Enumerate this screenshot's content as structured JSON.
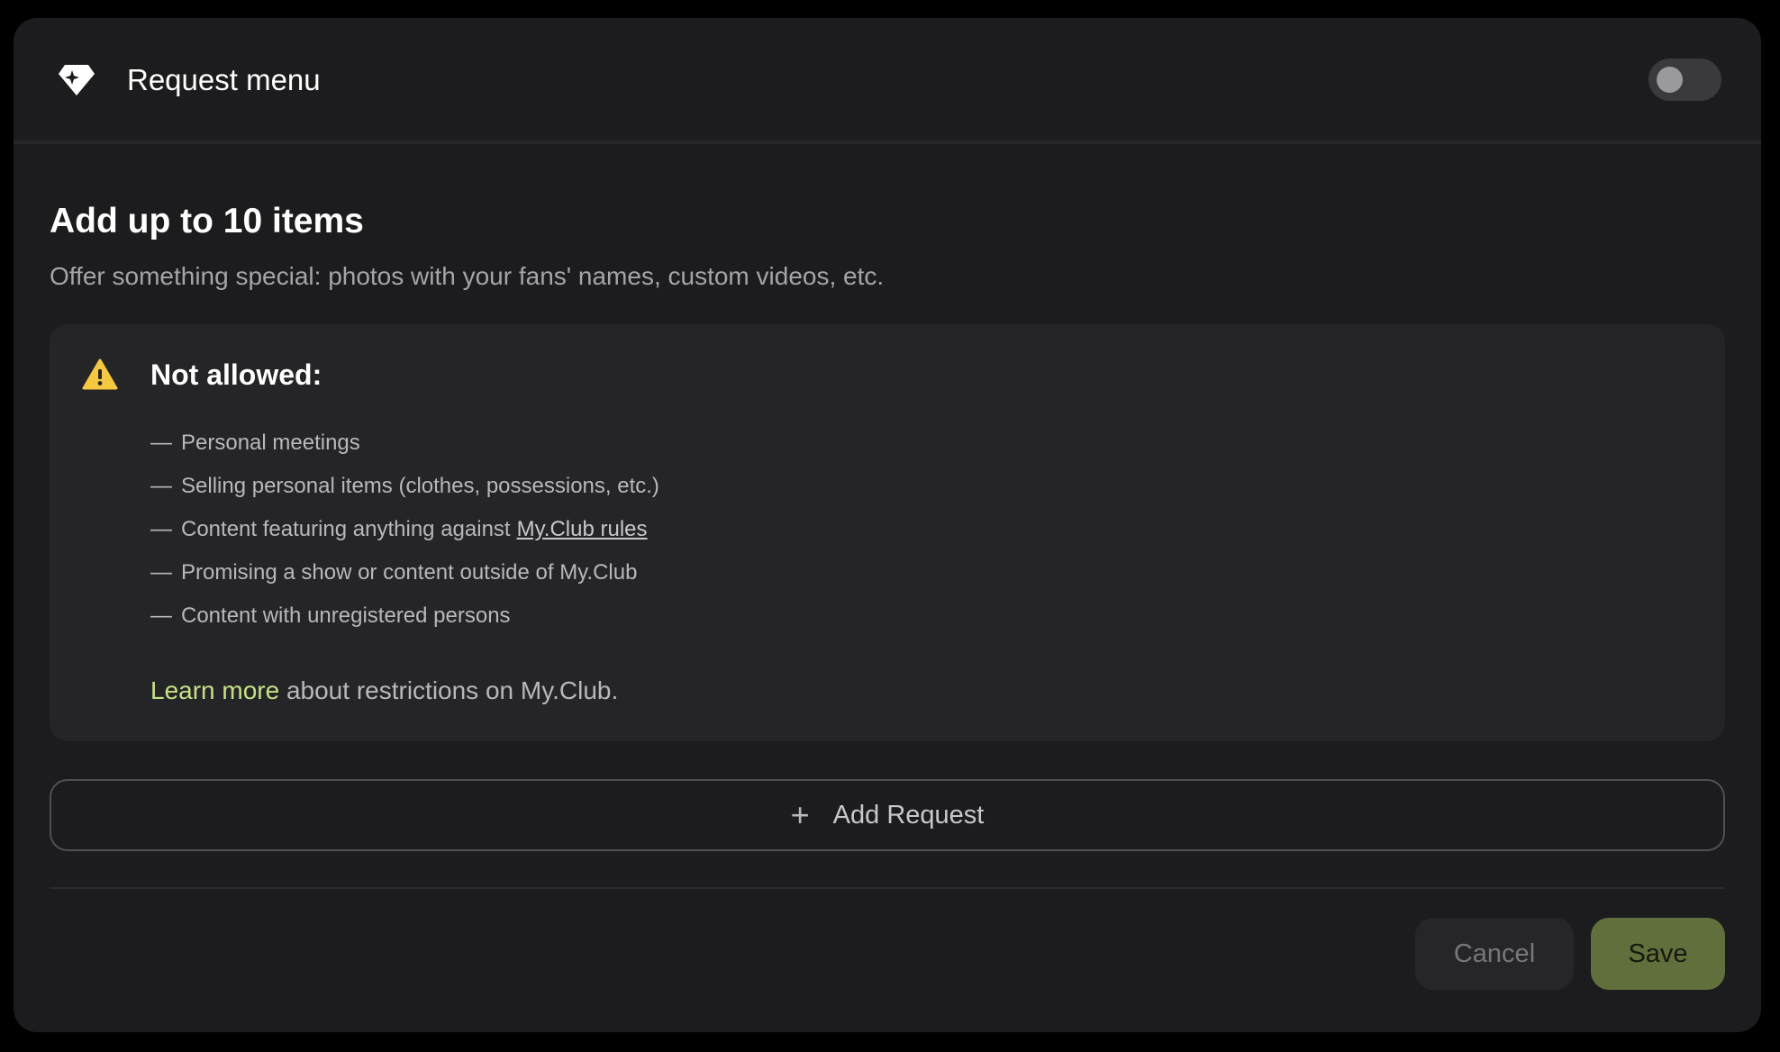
{
  "header": {
    "icon": "gem-icon",
    "title": "Request menu",
    "toggle_on": false
  },
  "main": {
    "heading": "Add up to 10 items",
    "subtitle": "Offer something special: photos with your fans' names, custom videos, etc."
  },
  "notice": {
    "icon": "warning-icon",
    "title": "Not allowed:",
    "dash": "—",
    "items": [
      "Personal meetings",
      "Selling personal items (clothes, possessions, etc.)",
      "Content featuring anything against",
      "Promising a show or content outside of My.Club",
      "Content with unregistered persons"
    ],
    "rules_link": "My.Club rules",
    "learn_link": "Learn more",
    "learn_text": " about restrictions on My.Club."
  },
  "add_button": {
    "icon": "plus-icon",
    "plus": "+",
    "label": "Add Request"
  },
  "footer": {
    "cancel_label": "Cancel",
    "save_label": "Save"
  },
  "colors": {
    "accent": "#c5e186",
    "save_bg": "#616f3c",
    "warning": "#f5c842"
  }
}
